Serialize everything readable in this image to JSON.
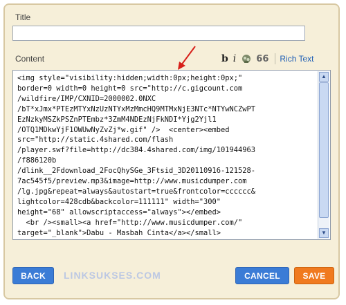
{
  "dialog": {
    "title_label": "Title",
    "title_value": "",
    "content_label": "Content"
  },
  "toolbar": {
    "bold_label": "b",
    "italic_label": "i",
    "image_icon": "image-insert-icon",
    "quote_label": "66",
    "rich_text_label": "Rich Text"
  },
  "editor": {
    "lines": [
      "<img style=\"visibility:hidden;width:0px;height:0px;\"",
      "border=0 width=0 height=0 src=\"http://c.gigcount.com",
      "/wildfire/IMP/CXNID=2000002.0NXC",
      "/bT*xJmx*PTEzMTYxNzUzNTYxMzMmcHQ9MTMxNjE3NTc*NTYwNCZwPT",
      "EzNzkyMSZkPSZnPTEmbz*3ZmM4NDEzNjFkNDI*Yjg2Yjl1",
      "/OTQ1MDkwYjF1OWUwNyZvZj*w.gif\" />  <center><embed",
      "src=\"http://static.4shared.com/flash",
      "/player.swf?file=http://dc384.4shared.com/img/101944963",
      "/f886120b",
      "/dlink__2Fdownload_2FocQhySGe_3Ftsid_3D20110916-121528-",
      "7ac545f5/preview.mp3&image=http://www.musicdumper.com",
      "/lg.jpg&repeat=always&autostart=true&frontcolor=cccccc&",
      "lightcolor=428cdb&backcolor=111111\" width=\"300\"",
      "height=\"68\" allowscriptaccess=\"always\"></embed>",
      "  <br /><small><a href=\"http://www.musicdumper.com/\"",
      "target=\"_blank\">Dabu - Masbah Cinta</a></small>"
    ]
  },
  "buttons": {
    "back_label": "BACK",
    "cancel_label": "CANCEL",
    "save_label": "SAVE"
  },
  "watermark": "LINKSUKSES.COM",
  "colors": {
    "dialog_bg": "#f6efd9",
    "blue_button": "#3b7cd6",
    "orange_button": "#f07a1f",
    "link": "#1f5fb5",
    "arrow": "#d7201a"
  }
}
